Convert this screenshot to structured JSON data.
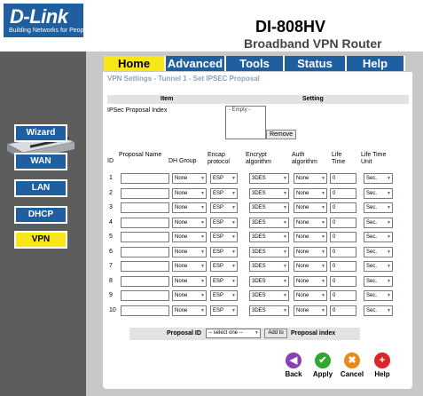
{
  "brand": {
    "logo": "D-Link",
    "tagline": "Building Networks for People"
  },
  "header": {
    "model": "DI-808HV",
    "subtitle": "Broadband VPN Router"
  },
  "nav": {
    "tabs": [
      "Home",
      "Advanced",
      "Tools",
      "Status",
      "Help"
    ],
    "active": "Home"
  },
  "sidebar": {
    "items": [
      "Wizard",
      "WAN",
      "LAN",
      "DHCP",
      "VPN"
    ],
    "active": "VPN"
  },
  "page": {
    "breadcrumb": "VPN Settings - Tunnel 1 - Set IPSEC Proposal",
    "item_header": "Item",
    "setting_header": "Setting",
    "proposal_index_label": "IPSec Proposal Index",
    "proposal_index_value": "- Empty -",
    "remove_label": "Remove"
  },
  "table": {
    "columns": [
      "ID",
      "Proposal Name",
      "DH Group",
      "Encap protocol",
      "Encrypt algorithm",
      "Auth algorithm",
      "Life Time",
      "Life Time Unit"
    ],
    "rows": [
      {
        "id": "1",
        "name": "",
        "dh": "None",
        "encap": "ESP",
        "encrypt": "3DES",
        "auth": "None",
        "life": "0",
        "unit": "Sec."
      },
      {
        "id": "2",
        "name": "",
        "dh": "None",
        "encap": "ESP",
        "encrypt": "3DES",
        "auth": "None",
        "life": "0",
        "unit": "Sec."
      },
      {
        "id": "3",
        "name": "",
        "dh": "None",
        "encap": "ESP",
        "encrypt": "3DES",
        "auth": "None",
        "life": "0",
        "unit": "Sec."
      },
      {
        "id": "4",
        "name": "",
        "dh": "None",
        "encap": "ESP",
        "encrypt": "3DES",
        "auth": "None",
        "life": "0",
        "unit": "Sec."
      },
      {
        "id": "5",
        "name": "",
        "dh": "None",
        "encap": "ESP",
        "encrypt": "3DES",
        "auth": "None",
        "life": "0",
        "unit": "Sec."
      },
      {
        "id": "6",
        "name": "",
        "dh": "None",
        "encap": "ESP",
        "encrypt": "3DES",
        "auth": "None",
        "life": "0",
        "unit": "Sec."
      },
      {
        "id": "7",
        "name": "",
        "dh": "None",
        "encap": "ESP",
        "encrypt": "3DES",
        "auth": "None",
        "life": "0",
        "unit": "Sec."
      },
      {
        "id": "8",
        "name": "",
        "dh": "None",
        "encap": "ESP",
        "encrypt": "3DES",
        "auth": "None",
        "life": "0",
        "unit": "Sec."
      },
      {
        "id": "9",
        "name": "",
        "dh": "None",
        "encap": "ESP",
        "encrypt": "3DES",
        "auth": "None",
        "life": "0",
        "unit": "Sec."
      },
      {
        "id": "10",
        "name": "",
        "dh": "None",
        "encap": "ESP",
        "encrypt": "3DES",
        "auth": "None",
        "life": "0",
        "unit": "Sec."
      }
    ]
  },
  "proposal_bar": {
    "label": "Proposal ID",
    "select_value": "-- select one --",
    "add_label": "Add to",
    "suffix": "Proposal index"
  },
  "actions": [
    {
      "label": "Back",
      "icon": "back-arrow-icon",
      "glyph": "◀",
      "color": "#8a3fb7"
    },
    {
      "label": "Apply",
      "icon": "checkmark-icon",
      "glyph": "✔",
      "color": "#2ea82e"
    },
    {
      "label": "Cancel",
      "icon": "cancel-x-icon",
      "glyph": "✖",
      "color": "#e88a1a"
    },
    {
      "label": "Help",
      "icon": "help-plus-icon",
      "glyph": "+",
      "color": "#d8262b"
    }
  ],
  "colors": {
    "brand_blue": "#1f5f9f",
    "active_yellow": "#f7e718",
    "frame_gray": "#c8c8c8"
  }
}
